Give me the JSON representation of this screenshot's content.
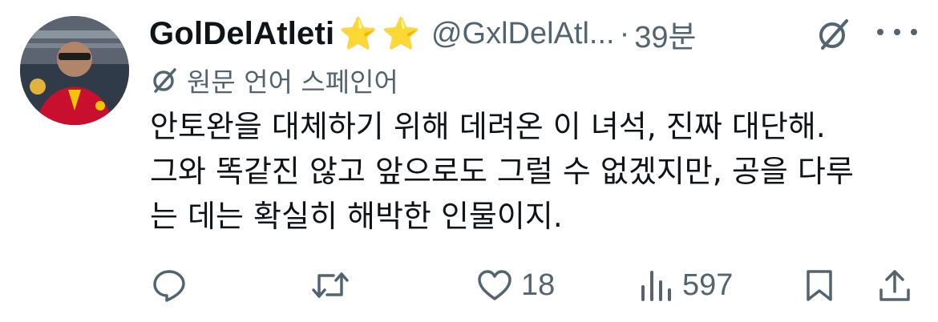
{
  "author": {
    "display_name": "GolDelAtleti",
    "emoji": [
      "⭐",
      "⭐"
    ],
    "handle": "@GxlDelAtl...",
    "separator": "·",
    "time": "39분"
  },
  "translation": {
    "label": "원문 언어 스페인어"
  },
  "tweet": {
    "lines": [
      "안토완을 대체하기 위해 데려온 이 녀석, 진짜 대단해.",
      "그와 똑같진 않고 앞으로도 그럴 수 없겠지만, 공을 다루",
      "는 데는 확실히 해박한 인물이지."
    ]
  },
  "actions": {
    "reply": {
      "icon": "reply-icon",
      "count": ""
    },
    "retweet": {
      "icon": "retweet-icon",
      "count": ""
    },
    "like": {
      "icon": "heart-icon",
      "count": "18"
    },
    "views": {
      "icon": "views-icon",
      "count": "597"
    },
    "bookmark": {
      "icon": "bookmark-icon"
    },
    "share": {
      "icon": "share-icon"
    }
  },
  "colors": {
    "text": "#0f1419",
    "secondary": "#536471",
    "star": "#f5b418"
  }
}
